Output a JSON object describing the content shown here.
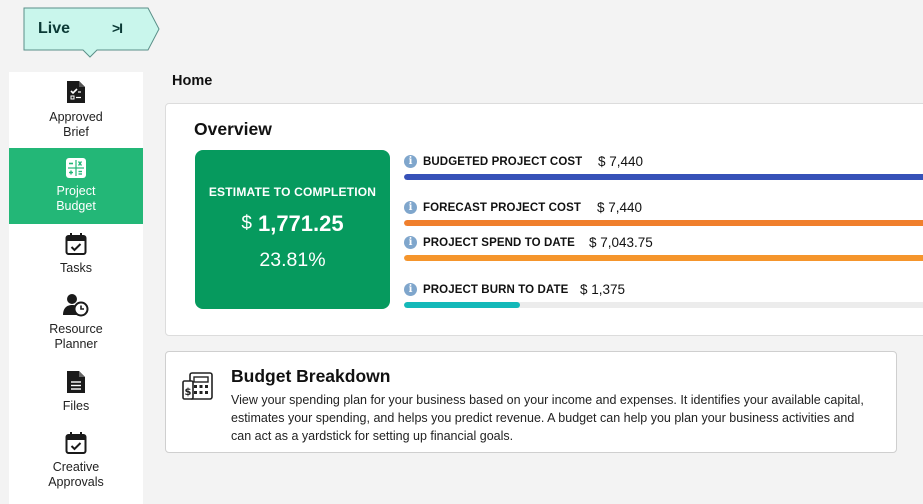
{
  "badge": {
    "label": "Live",
    "collapse_glyph": ">I"
  },
  "sidebar": {
    "items": [
      {
        "label_line1": "Approved",
        "label_line2": "Brief",
        "icon": "document-check-icon"
      },
      {
        "label_line1": "Project",
        "label_line2": "Budget",
        "icon": "calculator-icon",
        "active": true
      },
      {
        "label_line1": "Tasks",
        "label_line2": "",
        "icon": "calendar-check-icon"
      },
      {
        "label_line1": "Resource",
        "label_line2": "Planner",
        "icon": "user-clock-icon"
      },
      {
        "label_line1": "Files",
        "label_line2": "",
        "icon": "file-icon"
      },
      {
        "label_line1": "Creative",
        "label_line2": "Approvals",
        "icon": "calendar-check-icon"
      }
    ]
  },
  "page": {
    "title": "Home"
  },
  "overview": {
    "title": "Overview",
    "estimate": {
      "title": "ESTIMATE TO COMPLETION",
      "currency": "$",
      "amount": "1,771.25",
      "percent": "23.81%"
    },
    "metrics": [
      {
        "label": "BUDGETED PROJECT COST",
        "value": "$ 7,440",
        "fill_pct": 100,
        "color": "#3651b8"
      },
      {
        "label": "FORECAST PROJECT COST",
        "value": "$ 7,440",
        "fill_pct": 100,
        "color": "#f07f2c"
      },
      {
        "label": "PROJECT SPEND TO DATE",
        "value": "$ 7,043.75",
        "fill_pct": 100,
        "color": "#f5952c"
      },
      {
        "label": "PROJECT BURN TO DATE",
        "value": "$ 1,375",
        "fill_pct": 21.5,
        "color": "#14b9b9"
      }
    ],
    "info_glyph": "i"
  },
  "budget_breakdown": {
    "title": "Budget Breakdown",
    "description": "View your spending plan for your business based on your income and expenses. It identifies your available capital, estimates your spending, and helps you predict revenue. A budget can help you plan your business activities and can act as a yardstick for setting up financial goals."
  },
  "colors": {
    "accent": "#23b777",
    "estimate_bg": "#069a5e",
    "badge_bg": "#c9f6ec"
  }
}
